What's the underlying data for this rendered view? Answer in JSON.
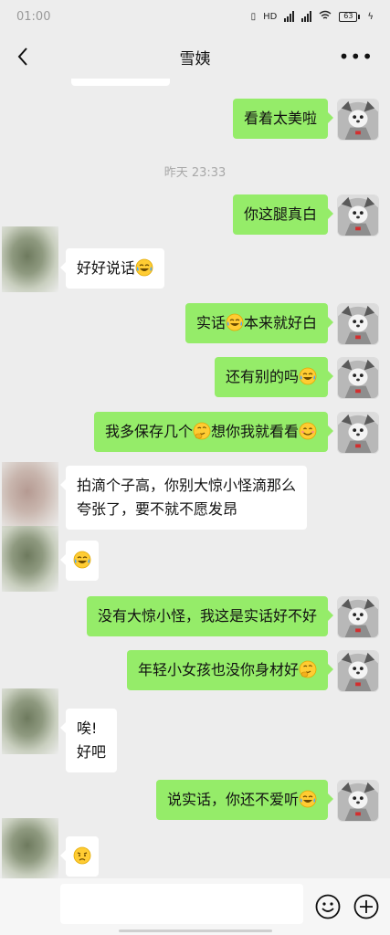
{
  "status_bar": {
    "time": "01:00",
    "battery": "63"
  },
  "header": {
    "title": "雪姨"
  },
  "timestamp": "昨天 23:33",
  "messages": [
    {
      "dir": "out",
      "text": "看着太美啦"
    },
    {
      "dir": "out",
      "text": "你这腿真白"
    },
    {
      "dir": "in",
      "text": "好好说话",
      "emoji": "laugh-cry"
    },
    {
      "dir": "out",
      "text": "实话",
      "emoji": "laugh-cry",
      "text2": "本来就好白"
    },
    {
      "dir": "out",
      "text": "还有别的吗",
      "emoji": "laugh-cry"
    },
    {
      "dir": "out",
      "text": "我多保存几个",
      "emoji": "thinking",
      "text2": "想你我就看看",
      "emoji2": "smile"
    },
    {
      "dir": "in",
      "text": "拍滴个子高，你别大惊小怪滴那么\n夸张了，要不就不愿发昂"
    },
    {
      "dir": "in",
      "emoji": "laugh-cry"
    },
    {
      "dir": "out",
      "text": "没有大惊小怪，我这是实话好不好"
    },
    {
      "dir": "out",
      "text": "年轻小女孩也没你身材好",
      "emoji": "thinking"
    },
    {
      "dir": "in",
      "text": "唉!\n好吧"
    },
    {
      "dir": "out",
      "text": "说实话，你还不爱听",
      "emoji": "laugh-cry"
    },
    {
      "dir": "in",
      "emoji": "worried"
    }
  ],
  "icons": {
    "back": "chevron-left-icon",
    "more": "more-dots-icon",
    "emoji_button": "smiley-icon",
    "plus_button": "plus-circle-icon"
  },
  "colors": {
    "outgoing_bubble": "#95ec69",
    "incoming_bubble": "#ffffff",
    "background": "#ededed"
  }
}
